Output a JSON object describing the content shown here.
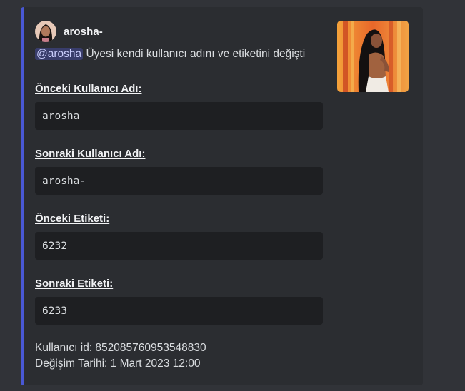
{
  "embed": {
    "accent_color": "#4958d4",
    "author": {
      "avatar_icon": "user-avatar",
      "name": "arosha-"
    },
    "description": {
      "mention": "@arosha",
      "text": " Üyesi kendi kullanıcı adını ve etiketini değişti"
    },
    "thumbnail_icon": "user-profile-image",
    "fields": [
      {
        "name": "Önceki Kullanıcı Adı:",
        "value": "arosha"
      },
      {
        "name": "Sonraki Kullanıcı Adı:",
        "value": "arosha-"
      },
      {
        "name": "Önceki Etiketi:",
        "value": "6232"
      },
      {
        "name": "Sonraki Etiketi:",
        "value": "6233"
      }
    ],
    "footer": {
      "user_id": "Kullanıcı id: 852085760953548830",
      "change_date": "Değişim Tarihi: 1 Mart 2023 12:00"
    }
  }
}
